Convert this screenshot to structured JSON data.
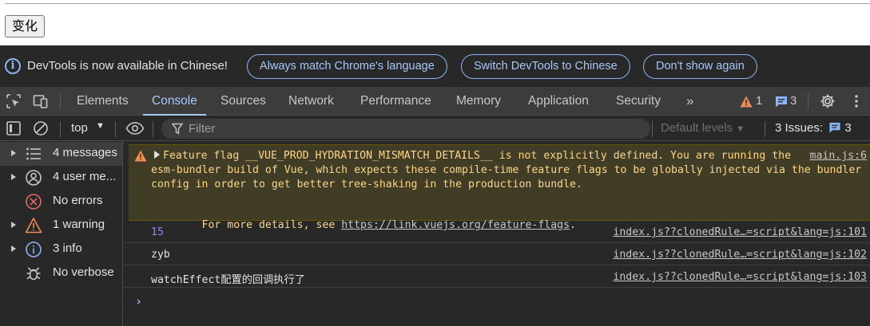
{
  "page": {
    "button_label": "变化"
  },
  "infobar": {
    "message": "DevTools is now available in Chinese!",
    "buttons": [
      "Always match Chrome's language",
      "Switch DevTools to Chinese",
      "Don't show again"
    ]
  },
  "tabs": [
    "Elements",
    "Console",
    "Sources",
    "Network",
    "Performance",
    "Memory",
    "Application",
    "Security"
  ],
  "active_tab": "Console",
  "tabbar_counts": {
    "warnings": "1",
    "messages": "3"
  },
  "toolbar": {
    "context": "top",
    "filter_placeholder": "Filter",
    "levels": "Default levels",
    "issues_label": "3 Issues:",
    "issues_count": "3"
  },
  "sidebar": {
    "items": [
      {
        "label": "4 messages",
        "icon": "list-icon"
      },
      {
        "label": "4 user me...",
        "icon": "user-icon"
      },
      {
        "label": "No errors",
        "icon": "error-icon"
      },
      {
        "label": "1 warning",
        "icon": "warning-icon"
      },
      {
        "label": "3 info",
        "icon": "info-icon"
      },
      {
        "label": "No verbose",
        "icon": "bug-icon"
      }
    ]
  },
  "console": {
    "warning": {
      "line1": "Feature flag __VUE_PROD_HYDRATION_MISMATCH_DETAILS__ is not explicitly defined. You are running the",
      "line2": "esm-bundler build of Vue, which expects these compile-time feature flags to be globally injected via the bundler",
      "line3": "config in order to get better tree-shaking in the production bundle.",
      "line5_prefix": "For more details, see ",
      "link": "https://link.vuejs.org/feature-flags",
      "line5_suffix": ".",
      "source": "main.js:6"
    },
    "logs": [
      {
        "message": "15",
        "source": "index.js??clonedRule…=script&lang=js:101"
      },
      {
        "message": "zyb",
        "source": "index.js??clonedRule…=script&lang=js:102"
      },
      {
        "message": "watchEffect配置的回调执行了",
        "source": "index.js??clonedRule…=script&lang=js:103"
      }
    ],
    "prompt": "›"
  },
  "colors": {
    "accent": "#a8c7fa",
    "warning": "#f28b54",
    "info": "#8ab4f8",
    "error": "#e46962"
  }
}
